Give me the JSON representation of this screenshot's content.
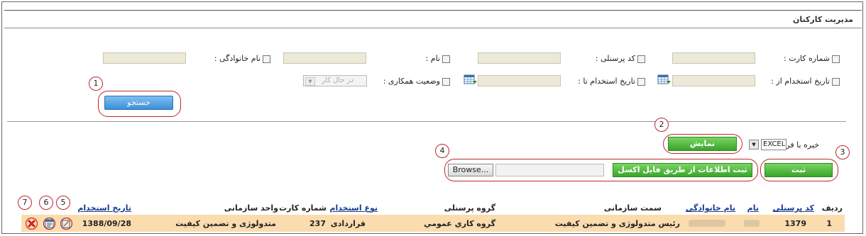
{
  "page": {
    "title": "مدیریت کارکنان"
  },
  "filters": {
    "card_number_label": "شماره کارت :",
    "personnel_code_label": "کد پرسنلی :",
    "first_name_label": "نام :",
    "last_name_label": "نام خانوادگی :",
    "hire_date_from_label": "تاریخ استخدام از :",
    "hire_date_to_label": "تاریخ استخدام تا :",
    "cooperation_status_label": "وضعیت همکاری :",
    "cooperation_status_value": "در حال کار"
  },
  "search_button_label": "جستجو",
  "export": {
    "save_format_label": "خیره با فرمت:",
    "format_value": "EXCEL",
    "show_button_label": "نمایش"
  },
  "import": {
    "browse_label": "Browse...",
    "excel_import_label": "ثبت اطلاعات از طریق فایل اکسل",
    "submit_label": "ثبت"
  },
  "callouts": [
    "1",
    "2",
    "3",
    "4",
    "5",
    "6",
    "7"
  ],
  "table": {
    "headers": {
      "row_no": "ردیف",
      "personnel_code": "کد پرسنلی",
      "first_name": "نام",
      "last_name": "نام خانوادگی",
      "position": "سمت سازمانی",
      "personnel_group": "گروه پرسنلی",
      "employment_type": "نوع استخدام",
      "card_number": "شماره کارت",
      "org_unit": "واحد سازمانی",
      "hire_date": "تاریخ استخدام"
    },
    "rows": [
      {
        "row_no": "1",
        "personnel_code": "1379",
        "position": "رئیس متدولوژی و تضمین کیفیت",
        "personnel_group": "گروه کاري عمومي",
        "employment_type": "قراردادی",
        "card_number": "237",
        "org_unit": "متدولوژی و تضمین کیفیت",
        "hire_date": "1388/09/28"
      }
    ]
  },
  "colors": {
    "accent_blue": "#3b8fd8",
    "accent_green": "#38a52a",
    "callout_red": "#c0272d",
    "row_highlight": "#fbdcae"
  },
  "icons": [
    "calendar-icon",
    "edit-icon",
    "details-icon",
    "delete-icon"
  ]
}
